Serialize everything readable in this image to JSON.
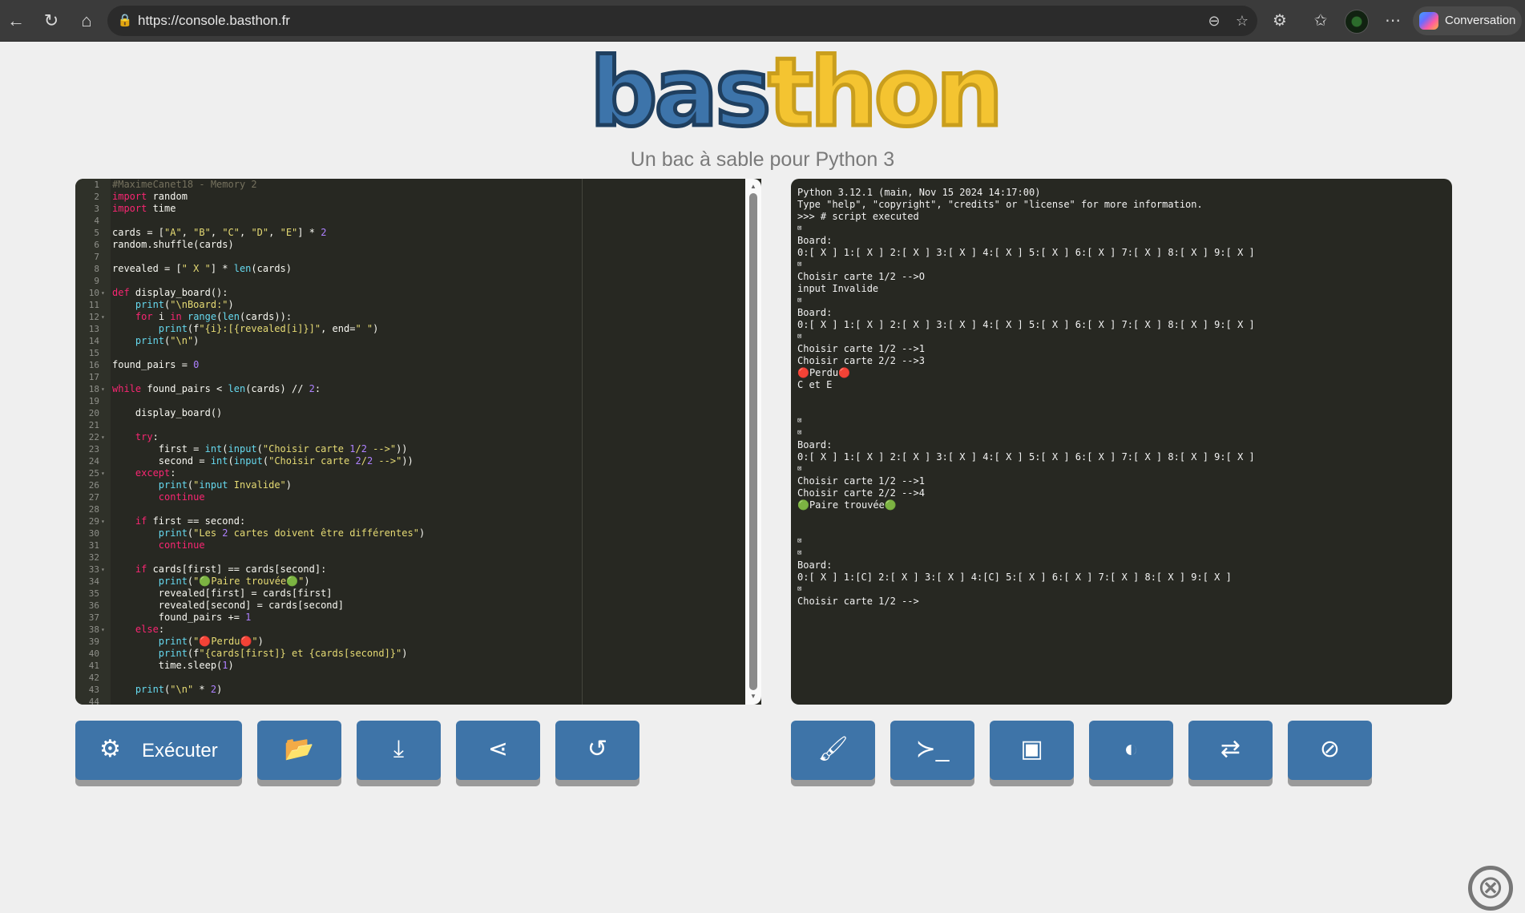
{
  "browser": {
    "url": "https://console.basthon.fr",
    "copilot_label": "Conversation",
    "icons": [
      "back-icon",
      "reload-icon",
      "home-icon",
      "lock-icon",
      "zoom-icon",
      "star-icon",
      "extensions-icon",
      "favorites-icon",
      "profile-avatar",
      "more-icon",
      "copilot-icon"
    ],
    "back_glyph": "←",
    "reload_glyph": "↻",
    "home_glyph": "⌂",
    "lock_glyph": "🔒",
    "zoom_glyph": "⊖",
    "star_glyph": "☆",
    "ext_glyph": "⚙",
    "fav_glyph": "✩",
    "more_glyph": "⋯"
  },
  "header": {
    "logo_blue": "bas",
    "logo_yellow": "thon",
    "tagline": "Un bac à sable pour Python 3"
  },
  "editor": {
    "lines": [
      "#MaximeCanet18 - Memory 2",
      "import random",
      "import time",
      "",
      "cards = [\"A\", \"B\", \"C\", \"D\", \"E\"] * 2",
      "random.shuffle(cards)",
      "",
      "revealed = [\" X \"] * len(cards)",
      "",
      "def display_board():",
      "    print(\"\\nBoard:\")",
      "    for i in range(len(cards)):",
      "        print(f\"{i}:[{revealed[i]}]\", end=\" \")",
      "    print(\"\\n\")",
      "",
      "found_pairs = 0",
      "",
      "while found_pairs < len(cards) // 2:",
      "",
      "    display_board()",
      "",
      "    try:",
      "        first = int(input(\"Choisir carte 1/2 -->\"))",
      "        second = int(input(\"Choisir carte 2/2 -->\"))",
      "    except:",
      "        print(\"input Invalide\")",
      "        continue",
      "",
      "    if first == second:",
      "        print(\"Les 2 cartes doivent être différentes\")",
      "        continue",
      "",
      "    if cards[first] == cards[second]:",
      "        print(\"🟢Paire trouvée🟢\")",
      "        revealed[first] = cards[first]",
      "        revealed[second] = cards[second]",
      "        found_pairs += 1",
      "    else:",
      "        print(\"🔴Perdu🔴\")",
      "        print(f\"{cards[first]} et {cards[second]}\")",
      "        time.sleep(1)",
      "",
      "    print(\"\\n\" * 2)",
      ""
    ],
    "folds": [
      10,
      12,
      18,
      22,
      25,
      29,
      33,
      38
    ]
  },
  "console": {
    "lines": [
      "Python 3.12.1 (main, Nov 15 2024 14:17:00)",
      "Type \"help\", \"copyright\", \"credits\" or \"license\" for more information.",
      ">>> # script executed",
      "⊠",
      "Board:",
      "0:[ X ] 1:[ X ] 2:[ X ] 3:[ X ] 4:[ X ] 5:[ X ] 6:[ X ] 7:[ X ] 8:[ X ] 9:[ X ]",
      "⊠",
      "Choisir carte 1/2 -->O",
      "input Invalide",
      "⊠",
      "Board:",
      "0:[ X ] 1:[ X ] 2:[ X ] 3:[ X ] 4:[ X ] 5:[ X ] 6:[ X ] 7:[ X ] 8:[ X ] 9:[ X ]",
      "⊠",
      "Choisir carte 1/2 -->1",
      "Choisir carte 2/2 -->3",
      "🔴Perdu🔴",
      "C et E",
      "",
      "",
      "⊠",
      "⊠",
      "Board:",
      "0:[ X ] 1:[ X ] 2:[ X ] 3:[ X ] 4:[ X ] 5:[ X ] 6:[ X ] 7:[ X ] 8:[ X ] 9:[ X ]",
      "⊠",
      "Choisir carte 1/2 -->1",
      "Choisir carte 2/2 -->4",
      "🟢Paire trouvée🟢",
      "",
      "",
      "⊠",
      "⊠",
      "Board:",
      "0:[ X ] 1:[C] 2:[ X ] 3:[ X ] 4:[C] 5:[ X ] 6:[ X ] 7:[ X ] 8:[ X ] 9:[ X ]",
      "⊠",
      "Choisir carte 1/2 -->"
    ]
  },
  "toolbar_left": {
    "run_label": "Exécuter",
    "run_glyph": "⚙",
    "open_glyph": "📂",
    "download_glyph": "⤓",
    "share_glyph": "⋖",
    "reset_glyph": "↺"
  },
  "toolbar_right": {
    "clear_glyph": "🖌",
    "terminal_glyph": "≻_",
    "image_glyph": "▣",
    "contrast_glyph": "◐",
    "swap_glyph": "⇄",
    "hide_glyph": "⊘"
  },
  "help_glyph": "⊗",
  "colors": {
    "accent": "#3e74a8",
    "logo_yellow": "#f4c431",
    "editor_bg": "#272822"
  }
}
